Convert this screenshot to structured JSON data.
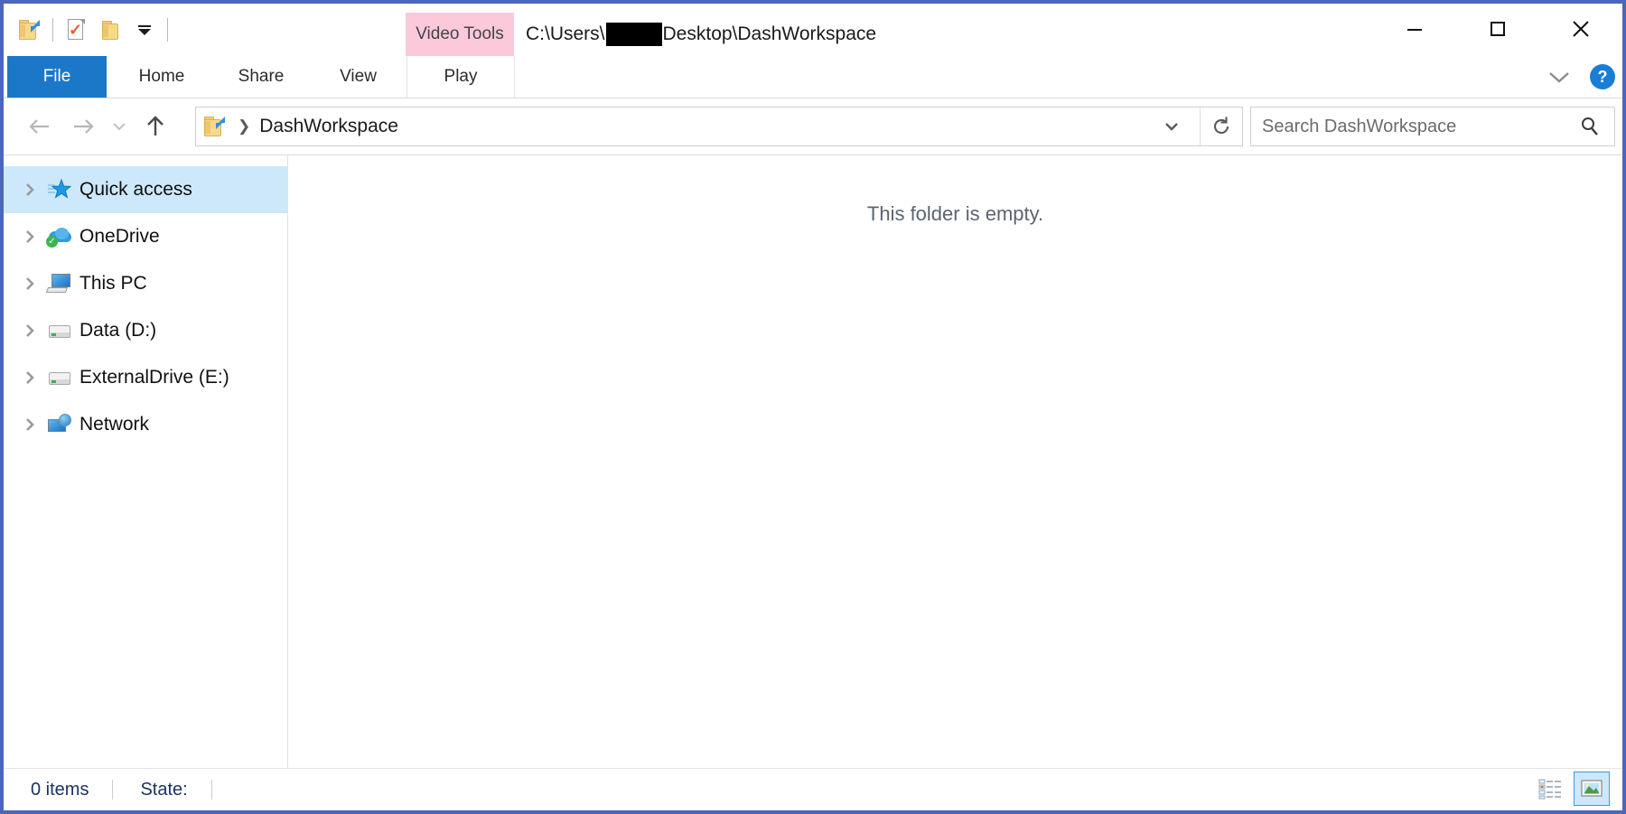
{
  "window": {
    "title_prefix": "C:\\Users\\",
    "title_suffix": "Desktop\\DashWorkspace",
    "title_redacted": true,
    "frame_color": "#4a66bd"
  },
  "quick_access_toolbar": {
    "items": [
      {
        "name": "explorer-icon",
        "label": "File Explorer"
      },
      {
        "name": "properties-icon",
        "label": "Properties"
      },
      {
        "name": "new-folder-icon",
        "label": "New folder"
      },
      {
        "name": "customize-dropdown",
        "label": "Customize Quick Access Toolbar"
      }
    ]
  },
  "contextual_tab": {
    "label": "Video Tools",
    "color": "#fbc9da"
  },
  "ribbon": {
    "tabs": [
      {
        "label": "File",
        "selected": true
      },
      {
        "label": "Home",
        "selected": false
      },
      {
        "label": "Share",
        "selected": false
      },
      {
        "label": "View",
        "selected": false
      },
      {
        "label": "Play",
        "selected": false,
        "contextual": true
      }
    ],
    "expand_label": "Expand the Ribbon",
    "help_label": "?"
  },
  "window_controls": {
    "minimize": "Minimize",
    "maximize": "Maximize",
    "close": "Close"
  },
  "navigation": {
    "back": "Back",
    "forward": "Forward",
    "recent": "Recent locations",
    "up": "Up"
  },
  "address_bar": {
    "crumb": "DashWorkspace",
    "dropdown": "Previous locations",
    "refresh": "Refresh"
  },
  "search": {
    "placeholder": "Search DashWorkspace"
  },
  "sidebar": {
    "items": [
      {
        "label": "Quick access",
        "icon": "star-icon",
        "selected": true
      },
      {
        "label": "OneDrive",
        "icon": "cloud-icon",
        "selected": false
      },
      {
        "label": "This PC",
        "icon": "computer-icon",
        "selected": false
      },
      {
        "label": "Data (D:)",
        "icon": "drive-icon",
        "selected": false
      },
      {
        "label": "ExternalDrive (E:)",
        "icon": "drive-icon",
        "selected": false
      },
      {
        "label": "Network",
        "icon": "network-icon",
        "selected": false
      }
    ]
  },
  "content": {
    "empty_message": "This folder is empty."
  },
  "status_bar": {
    "item_count": "0 items",
    "state_label": "State:",
    "views": [
      {
        "name": "details-view",
        "label": "Details view",
        "active": false
      },
      {
        "name": "large-icons-view",
        "label": "Large icons view",
        "active": true
      }
    ]
  }
}
